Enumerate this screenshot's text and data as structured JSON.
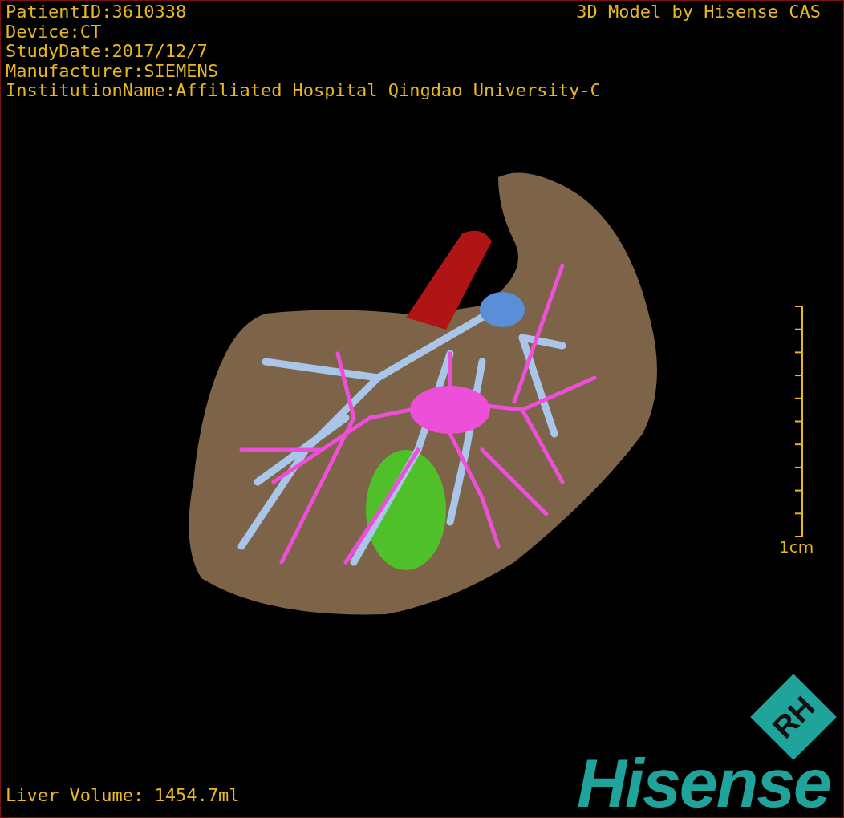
{
  "info_lines": [
    "PatientID:3610338",
    "Device:CT",
    "StudyDate:2017/12/7",
    "Manufacturer:SIEMENS",
    "InstitutionName:Affiliated Hospital Qingdao University-C"
  ],
  "credit": "3D Model by Hisense CAS",
  "scale_bar": {
    "label": "1cm"
  },
  "liver_volume": "Liver Volume: 1454.7ml",
  "logo": {
    "mark": "RH",
    "wordmark": "Hisense"
  }
}
